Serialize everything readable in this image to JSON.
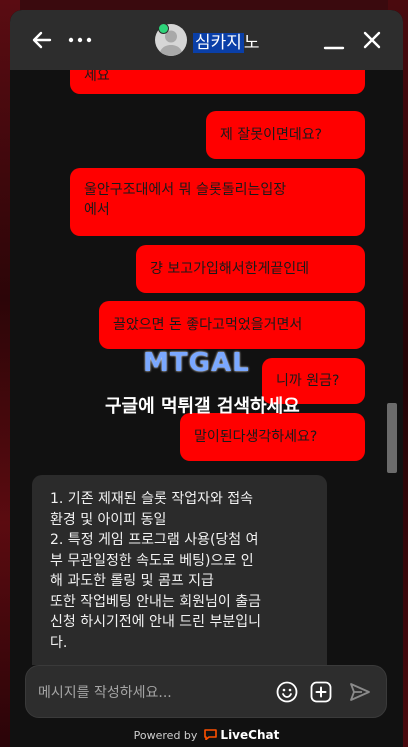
{
  "header": {
    "agent_name_highlight": "심카지",
    "agent_name_rest": "노"
  },
  "messages": [
    {
      "side": "visitor",
      "text": "세요"
    },
    {
      "side": "visitor",
      "text": "제 잘못이면데요?"
    },
    {
      "side": "visitor",
      "lines": [
        "울안구조대에서 뭐 슬롯돌리는입장",
        "에서"
      ]
    },
    {
      "side": "visitor",
      "text": "걍 보고가입해서한게끝인데"
    },
    {
      "side": "visitor",
      "text": "끌았으면 돈 좋다고먹었을거면서"
    },
    {
      "side": "visitor",
      "text": "니까 원금?"
    },
    {
      "side": "visitor",
      "text": "말이된다생각하세요?"
    }
  ],
  "agent_message": {
    "lines": [
      "1. 기존 제재된 슬롯 작업자와 접속",
      "환경 및 아이피 동일",
      "2. 특정 게임 프로그램 사용(당첨 여",
      "부 무관일정한 속도로 베팅)으로 인",
      "해 과도한 롤링 및 콤프 지급",
      "또한 작업베팅 안내는 회원님이 출금",
      "신청 하시기전에 안내 드린 부분입니",
      "다."
    ]
  },
  "watermark": {
    "logo": "MTGAL",
    "text": "구글에 먹튀갤 검색하세요"
  },
  "composer": {
    "placeholder": "메시지를 작성하세요..."
  },
  "footer": {
    "powered_by": "Powered by",
    "brand": "LiveChat"
  },
  "colors": {
    "visitor_bubble": "#ff0000",
    "agent_bubble": "#2b2b2b",
    "header": "#2d2d2d",
    "chat_bg": "#111111",
    "status_online": "#2ed47a"
  }
}
